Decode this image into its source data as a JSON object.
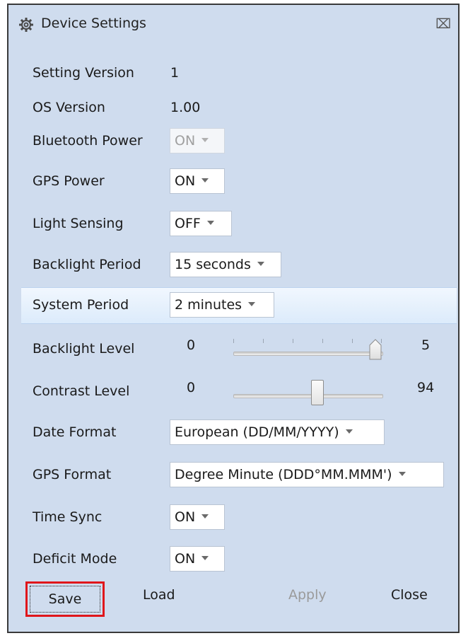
{
  "window": {
    "title": "Device Settings",
    "close_glyph": "⌧",
    "icon": "gear-icon"
  },
  "settings": {
    "setting_version": {
      "label": "Setting Version",
      "value": "1"
    },
    "os_version": {
      "label": "OS Version",
      "value": "1.00"
    },
    "bluetooth_power": {
      "label": "Bluetooth Power",
      "value": "ON",
      "enabled": false
    },
    "gps_power": {
      "label": "GPS Power",
      "value": "ON"
    },
    "light_sensing": {
      "label": "Light Sensing",
      "value": "OFF"
    },
    "backlight_period": {
      "label": "Backlight Period",
      "value": "15 seconds"
    },
    "system_period": {
      "label": "System Period",
      "value": "2 minutes"
    },
    "backlight_level": {
      "label": "Backlight Level",
      "min": "0",
      "max": "5",
      "value": 5
    },
    "contrast_level": {
      "label": "Contrast Level",
      "min": "0",
      "max": "94",
      "value": 57
    },
    "date_format": {
      "label": "Date Format",
      "value": "European (DD/MM/YYYY)"
    },
    "gps_format": {
      "label": "GPS Format",
      "value": "Degree Minute (DDD°MM.MMM')"
    },
    "time_sync": {
      "label": "Time Sync",
      "value": "ON"
    },
    "deficit_mode": {
      "label": "Deficit Mode",
      "value": "ON"
    }
  },
  "footer": {
    "save_label": "Save",
    "load_label": "Load",
    "apply_label": "Apply",
    "close_label": "Close"
  },
  "colors": {
    "window_bg": "#cfdcee",
    "highlight_row": "#dcebfb",
    "save_focus_border": "#e0161b",
    "disabled_text": "#9a9a9a"
  }
}
